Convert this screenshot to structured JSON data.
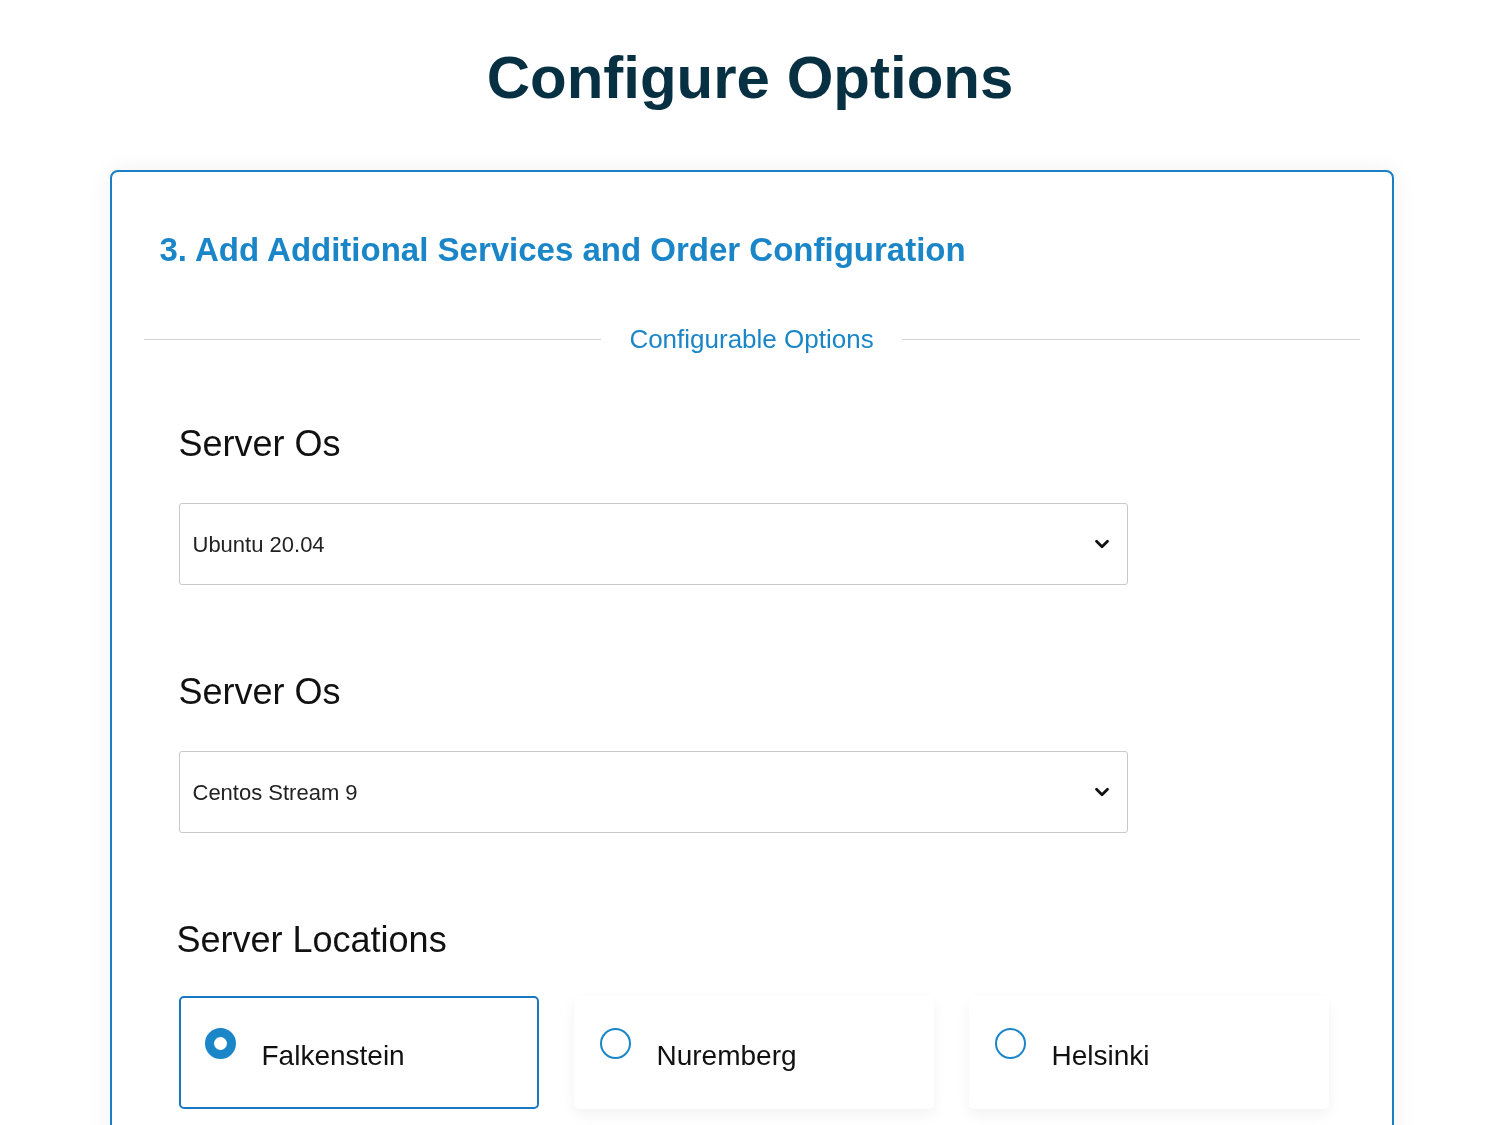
{
  "page_title": "Configure Options",
  "section": {
    "heading": "3. Add Additional Services and Order Configuration",
    "divider_label": "Configurable Options",
    "fields": [
      {
        "kind": "select",
        "label": "Server Os",
        "value": "Ubuntu 20.04"
      },
      {
        "kind": "select",
        "label": "Server Os",
        "value": "Centos Stream 9"
      },
      {
        "kind": "radio",
        "label": "Server Locations",
        "options": [
          {
            "label": "Falkenstein",
            "selected": true
          },
          {
            "label": "Nuremberg",
            "selected": false
          },
          {
            "label": "Helsinki",
            "selected": false
          }
        ]
      }
    ]
  }
}
